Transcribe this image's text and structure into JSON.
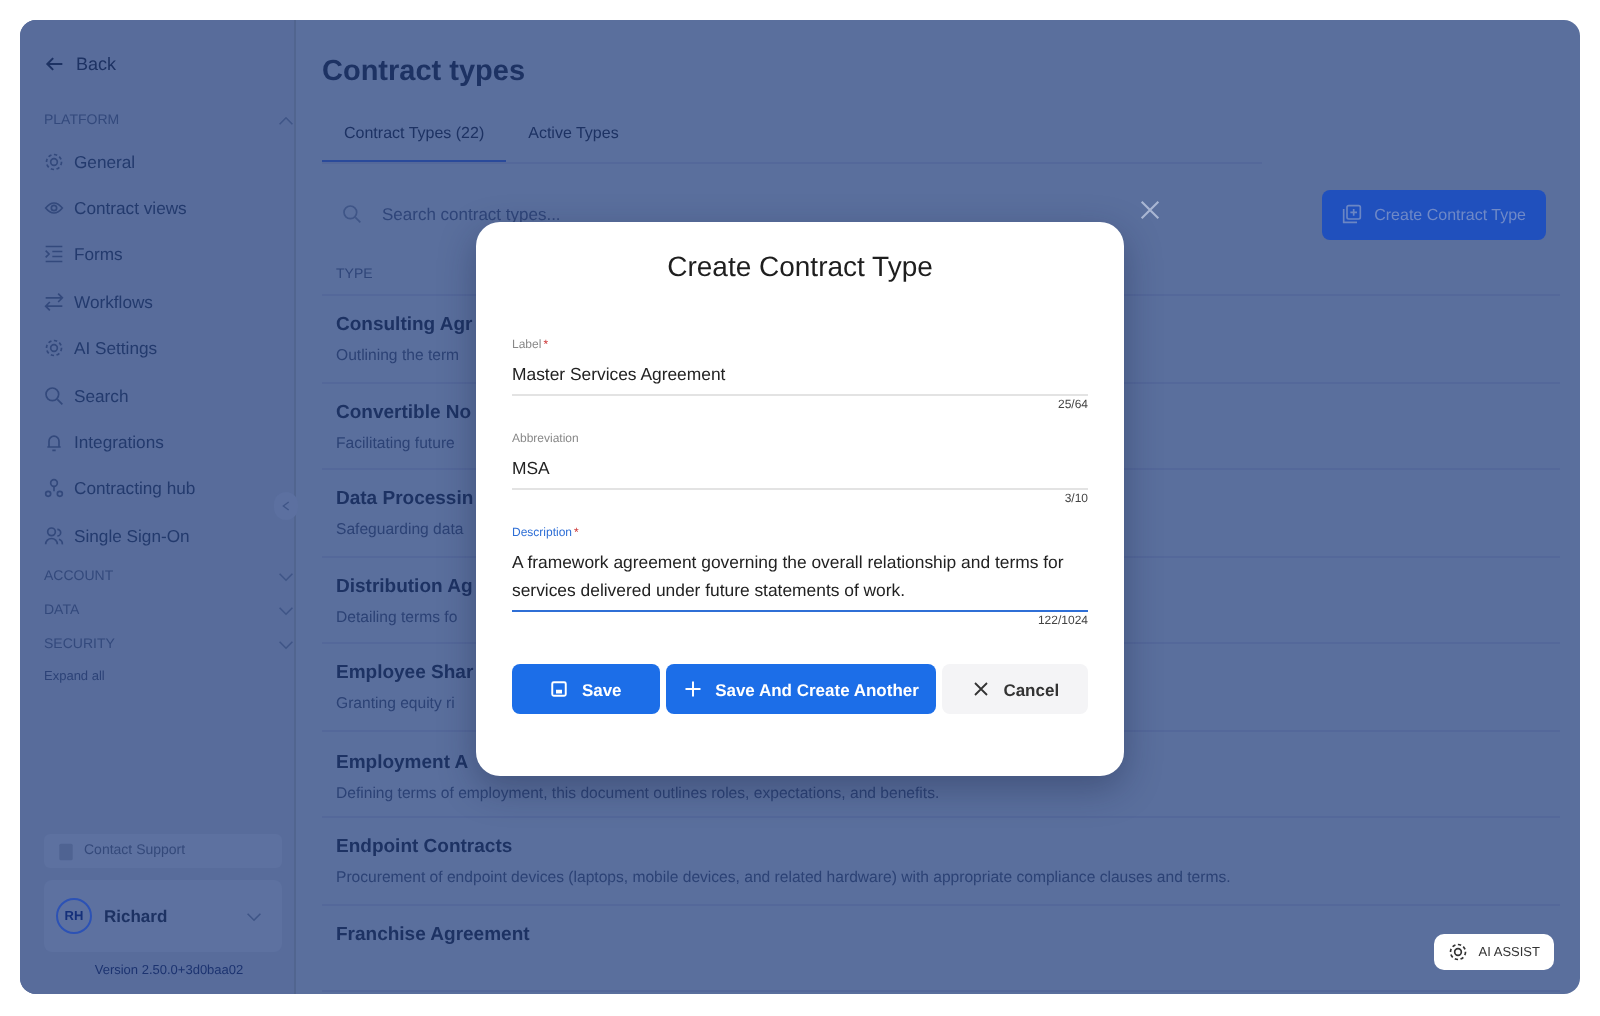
{
  "sidebar": {
    "back": "Back",
    "sections": [
      {
        "title": "PLATFORM",
        "expanded": true,
        "items": [
          "General",
          "Contract views",
          "Forms",
          "Workflows",
          "AI Settings",
          "Search",
          "Integrations",
          "Contracting hub",
          "Single Sign-On"
        ]
      },
      {
        "title": "ACCOUNT",
        "expanded": false
      },
      {
        "title": "DATA",
        "expanded": false
      },
      {
        "title": "SECURITY",
        "expanded": false
      }
    ],
    "expand_all": "Expand all",
    "support": "Contact Support",
    "user": {
      "initials": "RH",
      "name": "Richard"
    },
    "version": "Version 2.50.0+3d0baa02"
  },
  "page": {
    "title": "Contract types",
    "tabs": [
      {
        "label": "Contract Types (22)",
        "selected": true
      },
      {
        "label": "Active Types",
        "selected": false
      }
    ],
    "search": {
      "placeholder": "Search contract types..."
    },
    "create_button": "Create Contract Type",
    "table": {
      "columns": [
        "TYPE"
      ],
      "rows": [
        {
          "name": "Consulting Agr",
          "description": "Outlining the term"
        },
        {
          "name": "Convertible No",
          "description": "Facilitating future"
        },
        {
          "name": "Data Processin",
          "description": "Safeguarding data"
        },
        {
          "name": "Distribution Ag",
          "description": "Detailing terms fo"
        },
        {
          "name": "Employee Shar",
          "description": "Granting equity ri"
        },
        {
          "name": "Employment A",
          "description": "Defining terms of employment, this document outlines roles, expectations, and benefits."
        },
        {
          "name": "Endpoint Contracts",
          "description": "Procurement of endpoint devices (laptops, mobile devices, and related hardware) with appropriate compliance clauses and terms."
        },
        {
          "name": "Franchise Agreement"
        }
      ]
    },
    "ai_assist": "AI ASSIST"
  },
  "dialog": {
    "title": "Create Contract Type",
    "fields": [
      {
        "label": "Label",
        "required_mark": "*",
        "focused": false,
        "value": "Master Services Agreement",
        "counter": "25/64"
      },
      {
        "label": "Abbreviation",
        "focused": false,
        "value": "MSA",
        "counter": "3/10"
      },
      {
        "label": "Description",
        "required_mark": "*",
        "focused": true,
        "value": "A framework agreement governing the overall relationship and terms for services delivered under future statements of work.",
        "counter": "122/1024"
      }
    ],
    "buttons": [
      {
        "kind": "save",
        "label": "Save"
      },
      {
        "kind": "save_another",
        "label": "Save And Create Another"
      },
      {
        "kind": "cancel",
        "label": "Cancel"
      }
    ]
  }
}
